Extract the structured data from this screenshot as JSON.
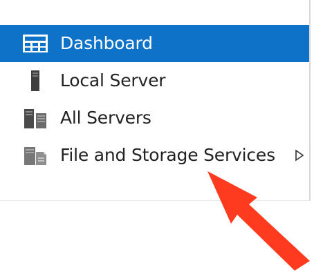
{
  "nav": {
    "items": [
      {
        "label": "Dashboard",
        "icon": "dashboard-icon",
        "selected": true
      },
      {
        "label": "Local Server",
        "icon": "server-icon",
        "selected": false
      },
      {
        "label": "All Servers",
        "icon": "servers-icon",
        "selected": false
      },
      {
        "label": "File and Storage Services",
        "icon": "file-storage-icon",
        "selected": false,
        "has_submenu": true
      }
    ]
  },
  "colors": {
    "selected_background": "#0e73c8",
    "annotation_arrow": "#ff3b1f"
  },
  "annotation": {
    "icon": "arrow-icon"
  }
}
